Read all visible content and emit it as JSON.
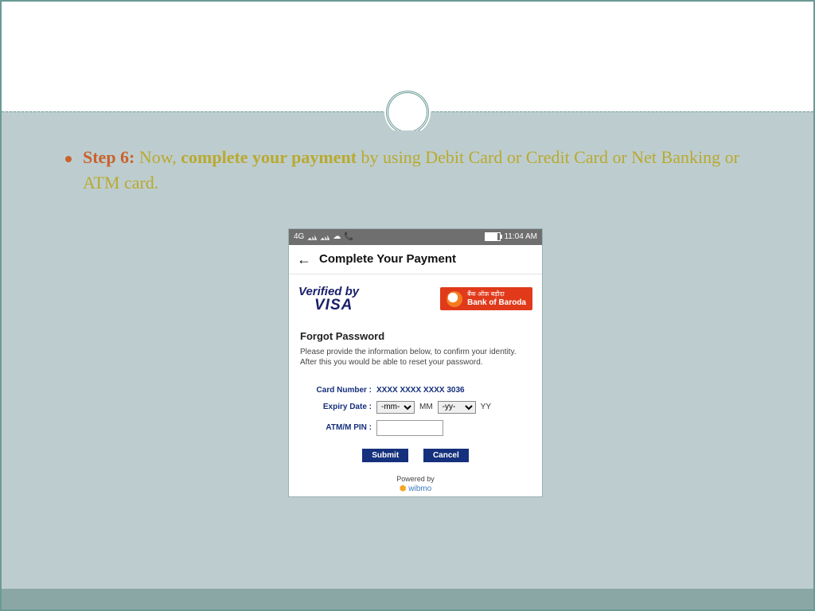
{
  "bullet": {
    "step_label": "Step 6:",
    "part1": " Now, ",
    "bold": "complete your payment",
    "part2": " by using Debit Card or Credit Card or Net Banking or ATM card."
  },
  "phone": {
    "status": {
      "net": "4G",
      "time": "11:04 AM"
    },
    "title": "Complete Your Payment",
    "vbv_line1": "Verified by",
    "vbv_line2": "VISA",
    "bank_hi": "बैंक ऑफ़ बड़ौदा",
    "bank_en": "Bank of Baroda",
    "forgot_heading": "Forgot Password",
    "forgot_text": "Please provide the information below, to confirm your identity. After this you would be able to reset your password.",
    "card_label": "Card Number :",
    "card_value": "XXXX XXXX XXXX 3036",
    "expiry_label": "Expiry Date :",
    "mm_placeholder": "-mm-",
    "mm_suffix": "MM",
    "yy_placeholder": "-yy-",
    "yy_suffix": "YY",
    "pin_label": "ATM/M PIN :",
    "submit": "Submit",
    "cancel": "Cancel",
    "powered": "Powered by",
    "wibmo": "wibmo"
  }
}
